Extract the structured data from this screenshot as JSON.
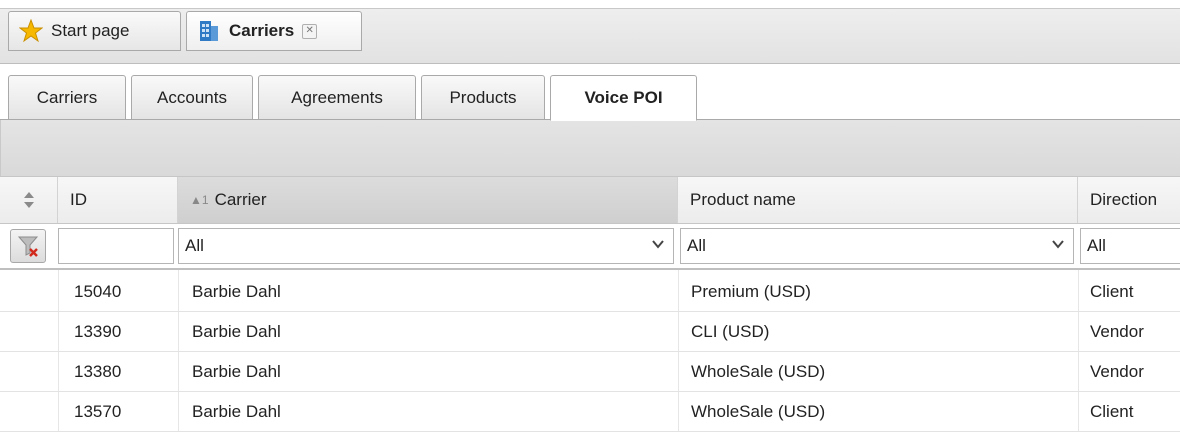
{
  "top_tabs": [
    {
      "label": "Start page",
      "icon": "star-icon"
    },
    {
      "label": "Carriers",
      "icon": "carriers-icon",
      "close": "✕"
    }
  ],
  "sub_tabs": [
    {
      "label": "Carriers"
    },
    {
      "label": "Accounts"
    },
    {
      "label": "Agreements"
    },
    {
      "label": "Products"
    },
    {
      "label": "Voice POI",
      "active": true
    }
  ],
  "grid": {
    "sort_indicator": "▲1",
    "columns": [
      "ID",
      "Carrier",
      "Product name",
      "Direction"
    ],
    "filters": {
      "id": "",
      "carrier": "All",
      "product": "All",
      "direction": "All"
    },
    "rows": [
      {
        "id": "15040",
        "carrier": "Barbie Dahl",
        "product": "Premium (USD)",
        "direction": "Client"
      },
      {
        "id": "13390",
        "carrier": "Barbie Dahl",
        "product": "CLI (USD)",
        "direction": "Vendor"
      },
      {
        "id": "13380",
        "carrier": "Barbie Dahl",
        "product": "WholeSale (USD)",
        "direction": "Vendor"
      },
      {
        "id": "13570",
        "carrier": "Barbie Dahl",
        "product": "WholeSale (USD)",
        "direction": "Client"
      }
    ]
  },
  "colors": {
    "accent_star": "#f6b800",
    "icon_blue": "#2f79c5"
  }
}
